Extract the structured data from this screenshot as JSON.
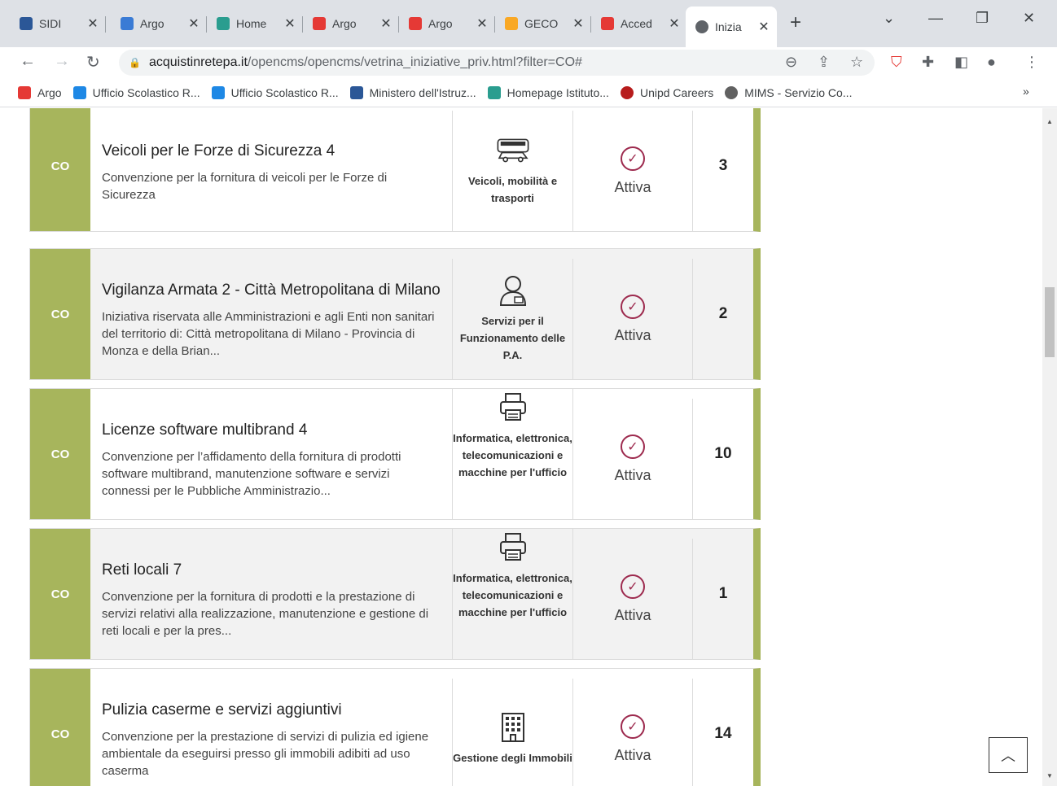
{
  "browser": {
    "tabs": [
      {
        "title": "SIDI",
        "color": "#2b5797"
      },
      {
        "title": "Argo",
        "color": "#3a7bd5"
      },
      {
        "title": "Home",
        "color": "#2a9d8f"
      },
      {
        "title": "Argo",
        "color": "#e53935"
      },
      {
        "title": "Argo",
        "color": "#e53935"
      },
      {
        "title": "GECO",
        "color": "#f9a825"
      },
      {
        "title": "Acced",
        "color": "#e53935"
      },
      {
        "title": "Inizia",
        "color": "#5f6368"
      }
    ],
    "close_glyph": "✕",
    "newtab_glyph": "+",
    "url_host": "acquistinretepa.it",
    "url_path": "/opencms/opencms/vetrina_iniziative_priv.html?filter=CO#",
    "bookmarks": [
      {
        "label": "Argo",
        "color": "#e53935"
      },
      {
        "label": "Ufficio Scolastico R...",
        "color": "#1e88e5"
      },
      {
        "label": "Ufficio Scolastico R...",
        "color": "#1e88e5"
      },
      {
        "label": "Ministero dell'Istruz...",
        "color": "#2b5797"
      },
      {
        "label": "Homepage Istituto...",
        "color": "#2a9d8f"
      },
      {
        "label": "Unipd Careers",
        "color": "#b71c1c"
      },
      {
        "label": "MIMS - Servizio Co...",
        "color": "#616161"
      }
    ],
    "bookmarks_more": "»"
  },
  "initiatives": [
    {
      "tag": "CO",
      "title": "Veicoli per le Forze di Sicurezza 4",
      "description": "Convenzione per la fornitura di veicoli per le Forze di Sicurezza",
      "category": "Veicoli, mobilità e trasporti",
      "category_icon": "vehicles-icon",
      "status": "Attiva",
      "count": "3"
    },
    {
      "tag": "CO",
      "title": "Vigilanza Armata 2 - Città Metropolitana di Milano",
      "description": "Iniziativa riservata alle Amministrazioni e agli Enti non sanitari del territorio di: Città metropolitana di Milano - Provincia di Monza e della Brian...",
      "category": "Servizi per il Funzionamento delle P.A.",
      "category_icon": "person-icon",
      "status": "Attiva",
      "count": "2"
    },
    {
      "tag": "CO",
      "title": "Licenze software multibrand 4",
      "description": "Convenzione per l’affidamento della fornitura di prodotti software multibrand, manutenzione software e servizi connessi per le Pubbliche Amministrazio...",
      "category": "Informatica, elettronica, telecomunicazioni e macchine per l'ufficio",
      "category_icon": "printer-icon",
      "status": "Attiva",
      "count": "10"
    },
    {
      "tag": "CO",
      "title": "Reti locali 7",
      "description": "Convenzione per la fornitura di prodotti e la prestazione di servizi relativi alla realizzazione, manutenzione e gestione di reti locali e per la pres...",
      "category": "Informatica, elettronica, telecomunicazioni e macchine per l'ufficio",
      "category_icon": "printer-icon",
      "status": "Attiva",
      "count": "1"
    },
    {
      "tag": "CO",
      "title": "Pulizia caserme e servizi aggiuntivi",
      "description": "Convenzione per la prestazione di servizi di pulizia ed igiene ambientale da eseguirsi presso gli immobili adibiti ad uso caserma",
      "category": "Gestione degli Immobili",
      "category_icon": "building-icon",
      "status": "Attiva",
      "count": "14"
    }
  ],
  "colors": {
    "tag_green": "#a7b55c",
    "status_accent": "#9d2a4e"
  }
}
